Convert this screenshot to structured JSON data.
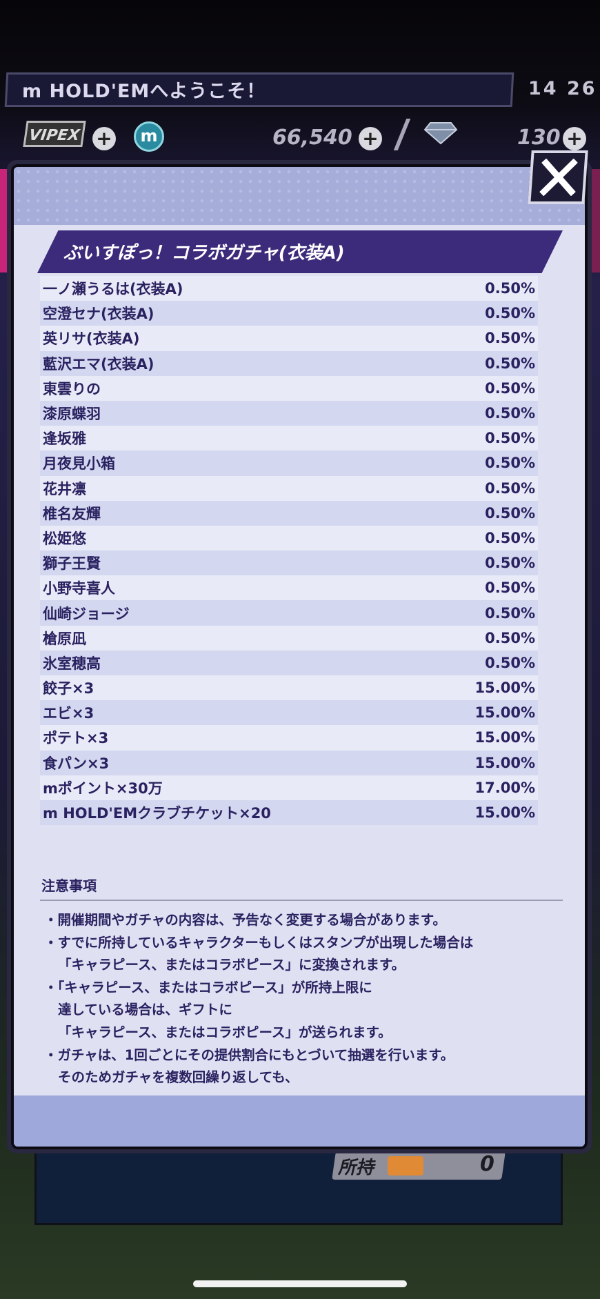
{
  "header": {
    "welcome": "m HOLD'EMへようこそ！",
    "clock": "14 26",
    "vip_label": "VIPEX",
    "coin_symbol": "m",
    "coins": "66,540",
    "gems": "130"
  },
  "modal": {
    "title": "ぶいすぽっ！コラボガチャ(衣装A)",
    "rates": [
      {
        "name": "一ノ瀬うるは(衣装A)",
        "rate": "0.50%"
      },
      {
        "name": "空澄セナ(衣装A)",
        "rate": "0.50%"
      },
      {
        "name": "英リサ(衣装A)",
        "rate": "0.50%"
      },
      {
        "name": "藍沢エマ(衣装A)",
        "rate": "0.50%"
      },
      {
        "name": "東雲りの",
        "rate": "0.50%"
      },
      {
        "name": "漆原蝶羽",
        "rate": "0.50%"
      },
      {
        "name": "逢坂雅",
        "rate": "0.50%"
      },
      {
        "name": "月夜見小箱",
        "rate": "0.50%"
      },
      {
        "name": "花井凛",
        "rate": "0.50%"
      },
      {
        "name": "椎名友輝",
        "rate": "0.50%"
      },
      {
        "name": "松姫悠",
        "rate": "0.50%"
      },
      {
        "name": "獅子王賢",
        "rate": "0.50%"
      },
      {
        "name": "小野寺喜人",
        "rate": "0.50%"
      },
      {
        "name": "仙崎ジョージ",
        "rate": "0.50%"
      },
      {
        "name": "槍原凪",
        "rate": "0.50%"
      },
      {
        "name": "氷室穂高",
        "rate": "0.50%"
      },
      {
        "name": "餃子×3",
        "rate": "15.00%"
      },
      {
        "name": "エビ×3",
        "rate": "15.00%"
      },
      {
        "name": "ポテト×3",
        "rate": "15.00%"
      },
      {
        "name": "食パン×3",
        "rate": "15.00%"
      },
      {
        "name": "mポイント×30万",
        "rate": "17.00%"
      },
      {
        "name": "m HOLD'EMクラブチケット×20",
        "rate": "15.00%"
      }
    ],
    "notes_title": "注意事項",
    "notes": {
      "l1": "・開催期間やガチャの内容は、予告なく変更する場合があります。",
      "l2": "・すでに所持しているキャラクターもしくはスタンプが出現した場合は",
      "l3": "「キャラピース、またはコラボピース」に変換されます。",
      "l4": "・「キャラピース、またはコラボピース」が所持上限に",
      "l5": "達している場合は、ギフトに",
      "l6": "「キャラピース、またはコラボピース」が送られます。",
      "l7": "・ガチャは、1回ごとにその提供割合にもとづいて抽選を行います。",
      "l8": "そのためガチャを複数回繰り返しても、"
    }
  },
  "footer": {
    "owned_label": "所持",
    "owned_value": "0"
  }
}
